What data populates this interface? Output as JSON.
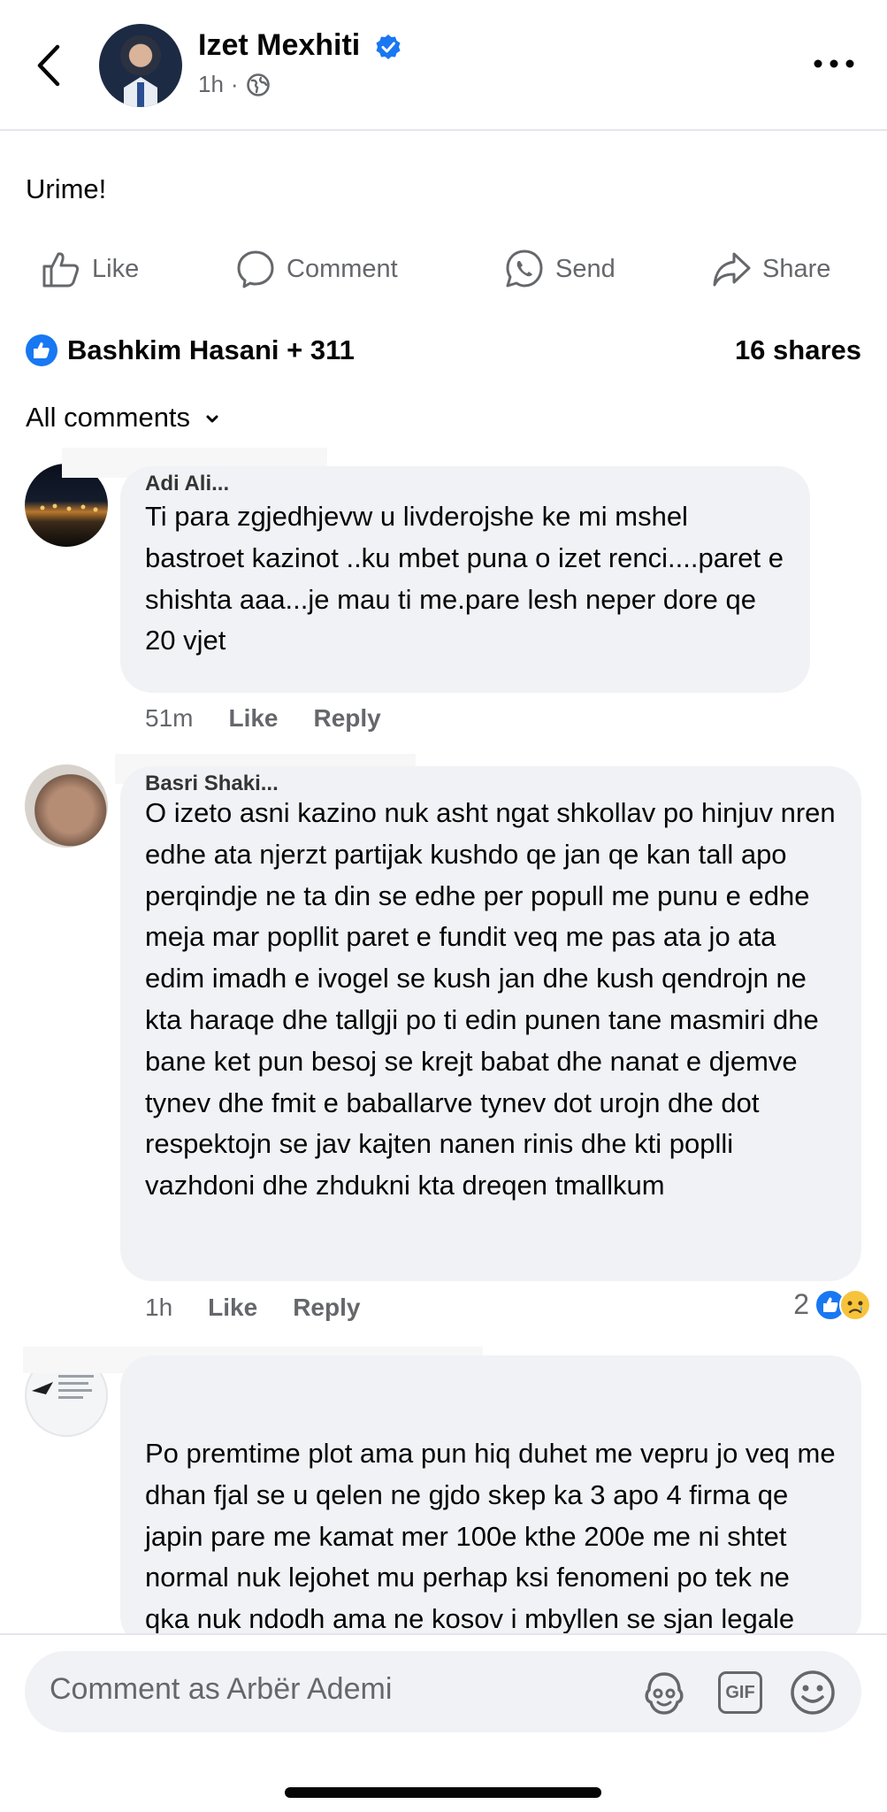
{
  "header": {
    "author": "Izet Mexhiti",
    "time": "1h",
    "separator": "·"
  },
  "post": {
    "text": "Urime!"
  },
  "actions": {
    "like": "Like",
    "comment": "Comment",
    "send": "Send",
    "share": "Share"
  },
  "reactions": {
    "summary": "Bashkim Hasani + 311",
    "shares": "16 shares"
  },
  "sort": {
    "label": "All comments"
  },
  "comments": [
    {
      "name": "Adi Ali...",
      "text": "Ti para zgjedhjevw u livderojshe ke mi mshel bastroet kazinot ..ku mbet puna o izet renci....paret e shishta aaa...je mau ti me.pare lesh neper dore qe 20 vjet",
      "time": "51m",
      "like": "Like",
      "reply": "Reply"
    },
    {
      "name": "Basri Shaki...",
      "text": "O izeto asni kazino nuk asht ngat shkollav po hinjuv nren edhe ata njerzt partijak kushdo qe jan qe kan tall apo perqindje ne ta din se edhe per popull me punu e edhe meja mar popllit paret e fundit veq me pas ata jo ata edim imadh e ivogel se kush jan dhe kush qendrojn ne kta haraqe dhe tallgji po ti edin punen tane masmiri dhe bane ket pun besoj se krejt babat dhe nanat e djemve tynev dhe fmit e baballarve tynev dot urojn dhe dot respektojn se jav kajten nanen rinis dhe kti poplli vazhdoni dhe zhdukni kta dreqen tmallkum",
      "time": "1h",
      "like": "Like",
      "reply": "Reply",
      "reaction_count": "2"
    },
    {
      "name": "",
      "text": "Po premtime plot ama pun hiq duhet me vepru jo veq me dhan fjal se u qelen ne gjdo skep ka 3 apo 4 firma qe japin pare me kamat mer 100e kthe 200e me ni shtet normal nuk lejohet mu perhap ksi fenomeni po tek ne qka nuk ndodh ama ne kosov i mbyllen se sjan legale me ligj"
    }
  ],
  "composer": {
    "placeholder": "Comment as Arbër Ademi",
    "gif": "GIF"
  },
  "colors": {
    "accent": "#1877f2",
    "muted": "#65676b",
    "bubble": "#f0f2f5"
  }
}
